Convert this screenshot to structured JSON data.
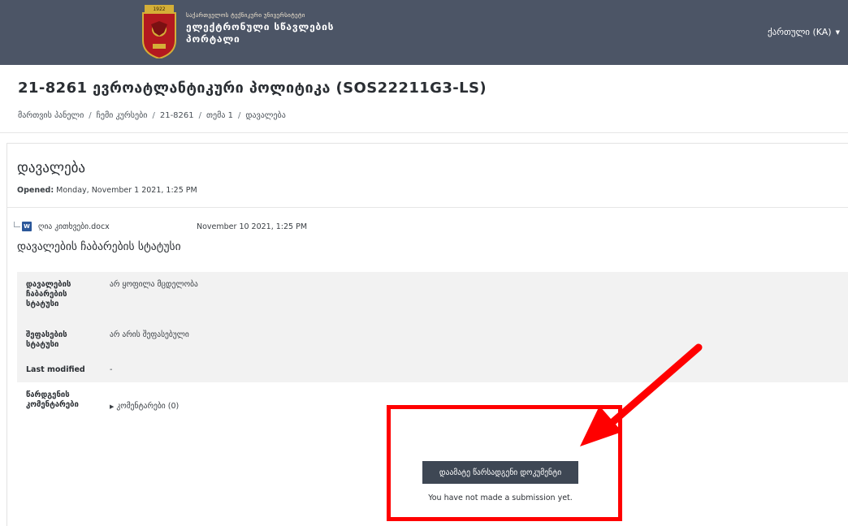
{
  "navbar": {
    "brand_line1": "საქართველოს ტექნიკური უნივერსიტეტი",
    "brand_line2": "ელექტრონული სწავლების",
    "brand_line3": "პორტალი",
    "language": "ქართული (KA)",
    "crest_text": "1922",
    "colors": {
      "background": "#4c5566",
      "crest_red": "#b3191f",
      "crest_gold": "#d4af37"
    }
  },
  "header": {
    "course_title": "21-8261 ევროატლანტიკური პოლიტიკა (SOS22211G3-LS)",
    "breadcrumb": [
      "მართვის პანელი",
      "ჩემი კურსები",
      "21-8261",
      "თემა 1",
      "დავალება"
    ],
    "separator": "/"
  },
  "activity": {
    "title": "დავალება",
    "opened_label": "Opened:",
    "opened_value": "Monday, November 1 2021, 1:25 PM",
    "file": {
      "name": "ღია კითხვები.docx",
      "date": "November 10 2021, 1:25 PM",
      "icon": "word-document-icon",
      "icon_letter": "W"
    },
    "status_heading": "დავალების ჩაბარების სტატუსი",
    "status_rows": [
      {
        "label": "დავალების ჩაბარების სტატუსი",
        "value": "არ ყოფილა მცდელობა"
      },
      {
        "label": "შეფასების სტატუსი",
        "value": "არ არის შეფასებული"
      },
      {
        "label": "Last modified",
        "value": "-"
      },
      {
        "label": "წარდგენის კომენტარები",
        "value": "კომენტარები (0)"
      }
    ]
  },
  "submission": {
    "button_label": "დაამატე წარსადგენი დოკუმენტი",
    "no_submission_text": "You have not made a submission yet."
  },
  "annotation": {
    "highlight_color": "#ff0000"
  }
}
